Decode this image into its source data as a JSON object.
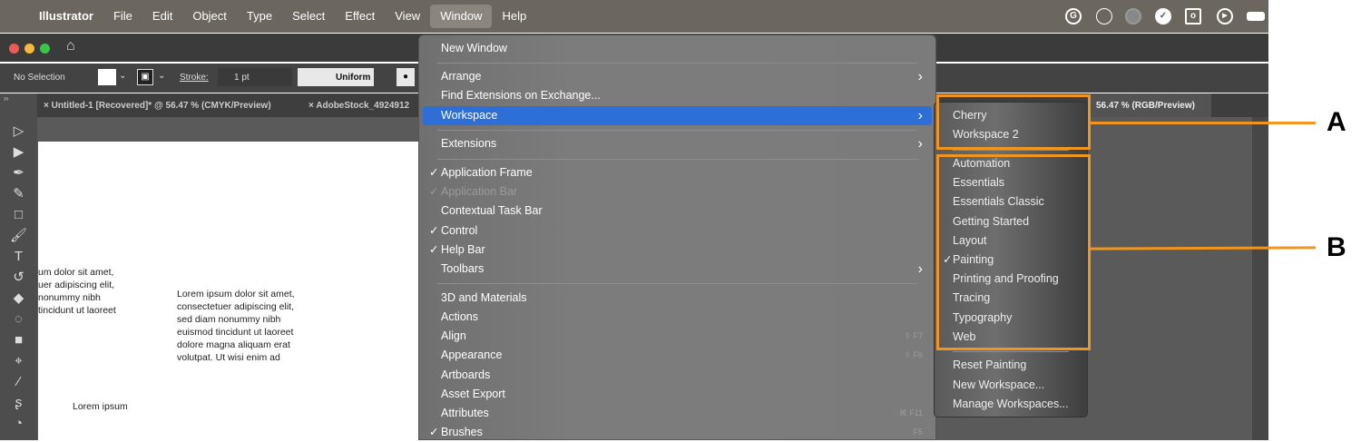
{
  "menubar": {
    "apple": "",
    "app": "Illustrator",
    "items": [
      "File",
      "Edit",
      "Object",
      "Type",
      "Select",
      "Effect",
      "View",
      "Window",
      "Help"
    ],
    "active": "Window"
  },
  "tray_icons": [
    "grammarly-icon",
    "link-icon",
    "globe-icon",
    "check-icon",
    "outlook-icon",
    "play-icon",
    "battery-icon"
  ],
  "control_bar": {
    "selection": "No Selection",
    "stroke_label": "Stroke:",
    "stroke_value": "1 pt",
    "profile": "Uniform"
  },
  "tabs": [
    {
      "label": "Untitled-1 [Recovered]* @ 56.47 % (CMYK/Preview)"
    },
    {
      "label": "AdobeStock_4924912"
    },
    {
      "label": "56.47 % (RGB/Preview)"
    }
  ],
  "canvas_text": {
    "block1": [
      "um dolor sit amet,",
      "uer adipiscing elit,",
      "nonummy nibh",
      "tincidunt ut laoreet"
    ],
    "block2": [
      "Lorem ipsum dolor sit amet,",
      "consectetuer adipiscing elit,",
      "sed diam nonummy nibh",
      "euismod tincidunt ut laoreet",
      "dolore magna aliquam erat",
      "volutpat. Ut wisi enim ad"
    ],
    "block3": "Lorem ipsum"
  },
  "window_menu": [
    {
      "label": "New Window"
    },
    {
      "sep": true
    },
    {
      "label": "Arrange",
      "submenu": true
    },
    {
      "label": "Find Extensions on Exchange..."
    },
    {
      "label": "Workspace",
      "submenu": true,
      "highlighted": true
    },
    {
      "sep": true
    },
    {
      "label": "Extensions",
      "submenu": true
    },
    {
      "sep": true
    },
    {
      "label": "Application Frame",
      "checked": true
    },
    {
      "label": "Application Bar",
      "checked": true,
      "disabled": true
    },
    {
      "label": "Contextual Task Bar"
    },
    {
      "label": "Control",
      "checked": true
    },
    {
      "label": "Help Bar",
      "checked": true
    },
    {
      "label": "Toolbars",
      "submenu": true
    },
    {
      "sep": true
    },
    {
      "label": "3D and Materials"
    },
    {
      "label": "Actions"
    },
    {
      "label": "Align",
      "shortcut": "⇧ F7"
    },
    {
      "label": "Appearance",
      "shortcut": "⇧ F6"
    },
    {
      "label": "Artboards"
    },
    {
      "label": "Asset Export"
    },
    {
      "label": "Attributes",
      "shortcut": "⌘ F11"
    },
    {
      "label": "Brushes",
      "checked": true,
      "shortcut": "F5"
    }
  ],
  "workspace_submenu": [
    {
      "label": "Cherry"
    },
    {
      "label": "Workspace 2"
    },
    {
      "sep": true
    },
    {
      "label": "Automation"
    },
    {
      "label": "Essentials"
    },
    {
      "label": "Essentials Classic"
    },
    {
      "label": "Getting Started"
    },
    {
      "label": "Layout"
    },
    {
      "label": "Painting",
      "checked": true
    },
    {
      "label": "Printing and Proofing"
    },
    {
      "label": "Tracing"
    },
    {
      "label": "Typography"
    },
    {
      "label": "Web"
    },
    {
      "sep": true
    },
    {
      "label": "Reset Painting"
    },
    {
      "label": "New Workspace..."
    },
    {
      "label": "Manage Workspaces..."
    }
  ],
  "annotations": {
    "a": "A",
    "b": "B",
    "color": "#f29420"
  },
  "colors": {
    "highlight": "#2d6fd6",
    "menubar": "#6c675e"
  }
}
